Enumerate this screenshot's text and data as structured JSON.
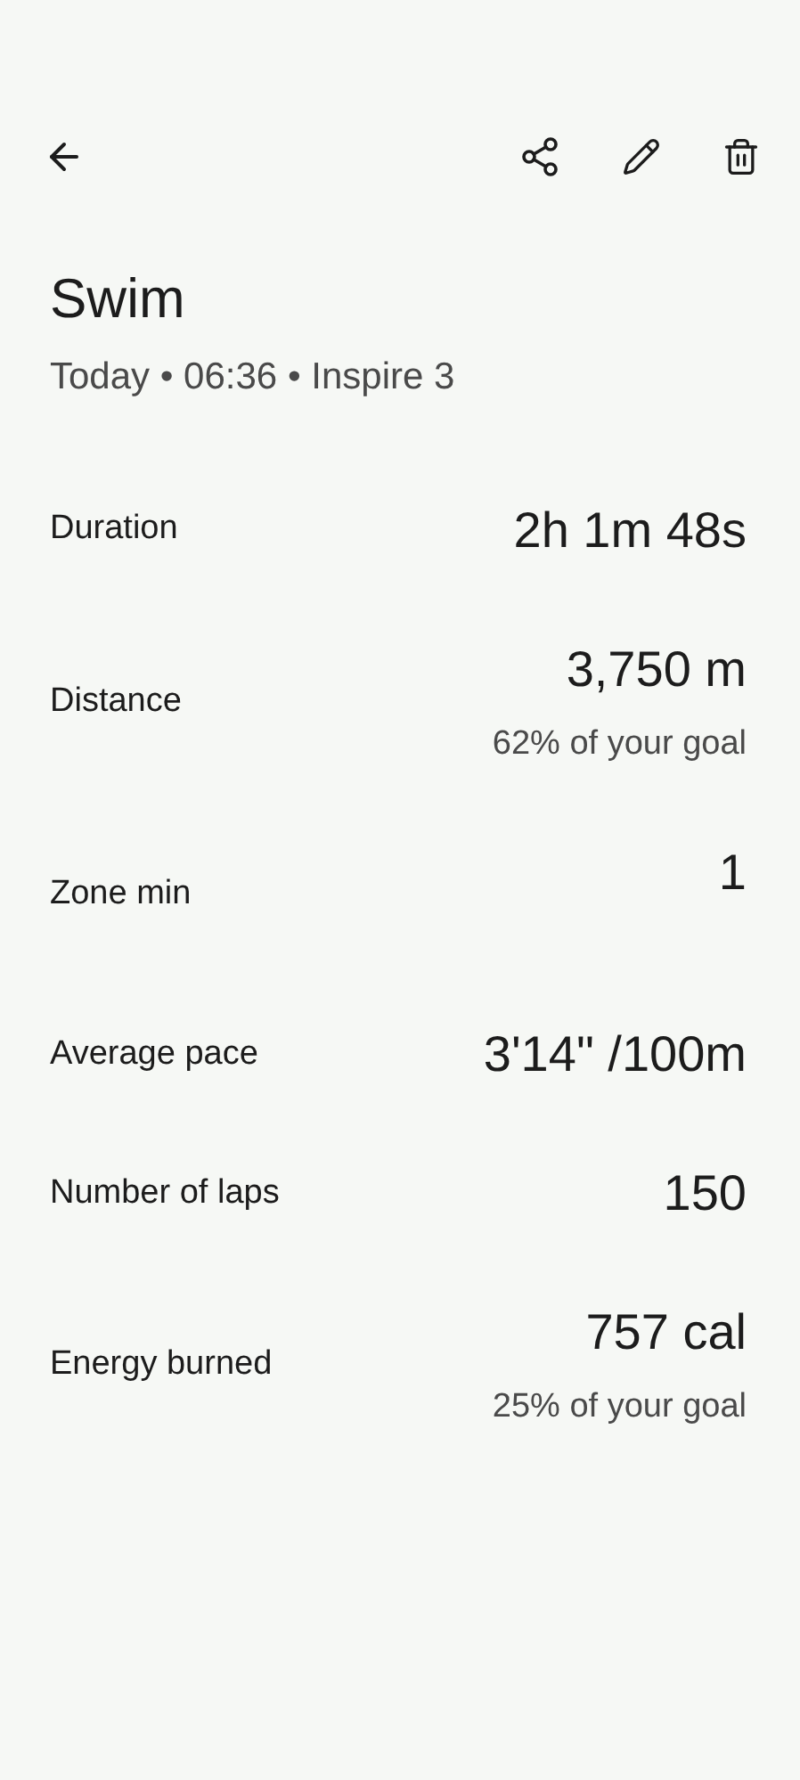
{
  "title": "Swim",
  "subtitle": "Today • 06:36 • Inspire 3",
  "stats": [
    {
      "label": "Duration",
      "value": "2h 1m 48s",
      "kind": "plain"
    },
    {
      "label": "Distance",
      "value": "3,750 m",
      "note": "62% of your goal",
      "kind": "goal"
    },
    {
      "label": "Zone min",
      "value": "1",
      "kind": "tall"
    },
    {
      "label": "Average pace",
      "value": "3'14\" /100m",
      "kind": "plain"
    },
    {
      "label": "Number of laps",
      "value": "150",
      "kind": "plain"
    },
    {
      "label": "Energy burned",
      "value": "757 cal",
      "note": "25% of your goal",
      "kind": "goal"
    }
  ]
}
